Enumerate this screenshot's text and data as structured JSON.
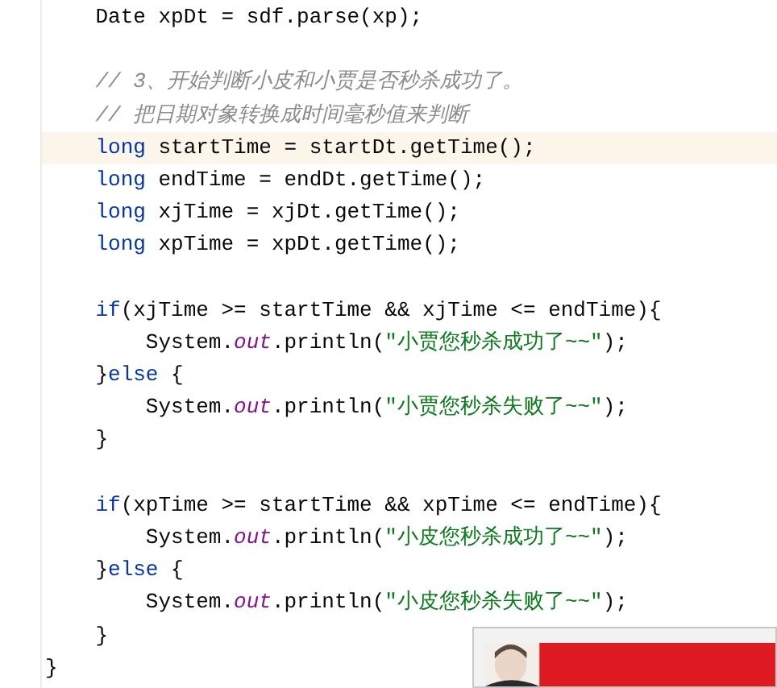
{
  "editor": {
    "lines": [
      {
        "current": false,
        "tokens": [
          {
            "kind": "plain",
            "text": "    Date xpDt = sdf.parse(xp);"
          }
        ]
      },
      {
        "current": false
      },
      {
        "current": false,
        "tokens": [
          {
            "kind": "comment",
            "text": "    // 3、开始判断小皮和小贾是否秒杀成功了。"
          }
        ]
      },
      {
        "current": false,
        "tokens": [
          {
            "kind": "comment",
            "text": "    // 把日期对象转换成时间毫秒值来判断"
          }
        ]
      },
      {
        "current": true,
        "tokens": [
          {
            "kind": "keyword",
            "text": "    long"
          },
          {
            "kind": "plain",
            "text": " startTime = startDt.getTime();"
          }
        ]
      },
      {
        "current": false,
        "tokens": [
          {
            "kind": "keyword",
            "text": "    long"
          },
          {
            "kind": "plain",
            "text": " endTime = endDt.getTime();"
          }
        ]
      },
      {
        "current": false,
        "tokens": [
          {
            "kind": "keyword",
            "text": "    long"
          },
          {
            "kind": "plain",
            "text": " xjTime = xjDt.getTime();"
          }
        ]
      },
      {
        "current": false,
        "tokens": [
          {
            "kind": "keyword",
            "text": "    long"
          },
          {
            "kind": "plain",
            "text": " xpTime = xpDt.getTime();"
          }
        ]
      },
      {
        "current": false
      },
      {
        "current": false,
        "tokens": [
          {
            "kind": "keyword",
            "text": "    if"
          },
          {
            "kind": "plain",
            "text": "(xjTime >= startTime && xjTime <= endTime){"
          }
        ]
      },
      {
        "current": false,
        "tokens": [
          {
            "kind": "plain",
            "text": "        System."
          },
          {
            "kind": "field",
            "text": "out"
          },
          {
            "kind": "plain",
            "text": ".println("
          },
          {
            "kind": "string",
            "text": "\"小贾您秒杀成功了~~\""
          },
          {
            "kind": "plain",
            "text": ");"
          }
        ]
      },
      {
        "current": false,
        "tokens": [
          {
            "kind": "plain",
            "text": "    }"
          },
          {
            "kind": "keyword",
            "text": "else"
          },
          {
            "kind": "plain",
            "text": " {"
          }
        ]
      },
      {
        "current": false,
        "tokens": [
          {
            "kind": "plain",
            "text": "        System."
          },
          {
            "kind": "field",
            "text": "out"
          },
          {
            "kind": "plain",
            "text": ".println("
          },
          {
            "kind": "string",
            "text": "\"小贾您秒杀失败了~~\""
          },
          {
            "kind": "plain",
            "text": ");"
          }
        ]
      },
      {
        "current": false,
        "tokens": [
          {
            "kind": "plain",
            "text": "    }"
          }
        ]
      },
      {
        "current": false
      },
      {
        "current": false,
        "tokens": [
          {
            "kind": "keyword",
            "text": "    if"
          },
          {
            "kind": "plain",
            "text": "(xpTime >= startTime && xpTime <= endTime){"
          }
        ]
      },
      {
        "current": false,
        "tokens": [
          {
            "kind": "plain",
            "text": "        System."
          },
          {
            "kind": "field",
            "text": "out"
          },
          {
            "kind": "plain",
            "text": ".println("
          },
          {
            "kind": "string",
            "text": "\"小皮您秒杀成功了~~\""
          },
          {
            "kind": "plain",
            "text": ");"
          }
        ]
      },
      {
        "current": false,
        "tokens": [
          {
            "kind": "plain",
            "text": "    }"
          },
          {
            "kind": "keyword",
            "text": "else"
          },
          {
            "kind": "plain",
            "text": " {"
          }
        ]
      },
      {
        "current": false,
        "tokens": [
          {
            "kind": "plain",
            "text": "        System."
          },
          {
            "kind": "field",
            "text": "out"
          },
          {
            "kind": "plain",
            "text": ".println("
          },
          {
            "kind": "string",
            "text": "\"小皮您秒杀失败了~~\""
          },
          {
            "kind": "plain",
            "text": ");"
          }
        ]
      },
      {
        "current": false,
        "tokens": [
          {
            "kind": "plain",
            "text": "    }"
          }
        ]
      },
      {
        "current": false,
        "tokens": [
          {
            "kind": "plain",
            "text": "}"
          }
        ]
      }
    ]
  }
}
